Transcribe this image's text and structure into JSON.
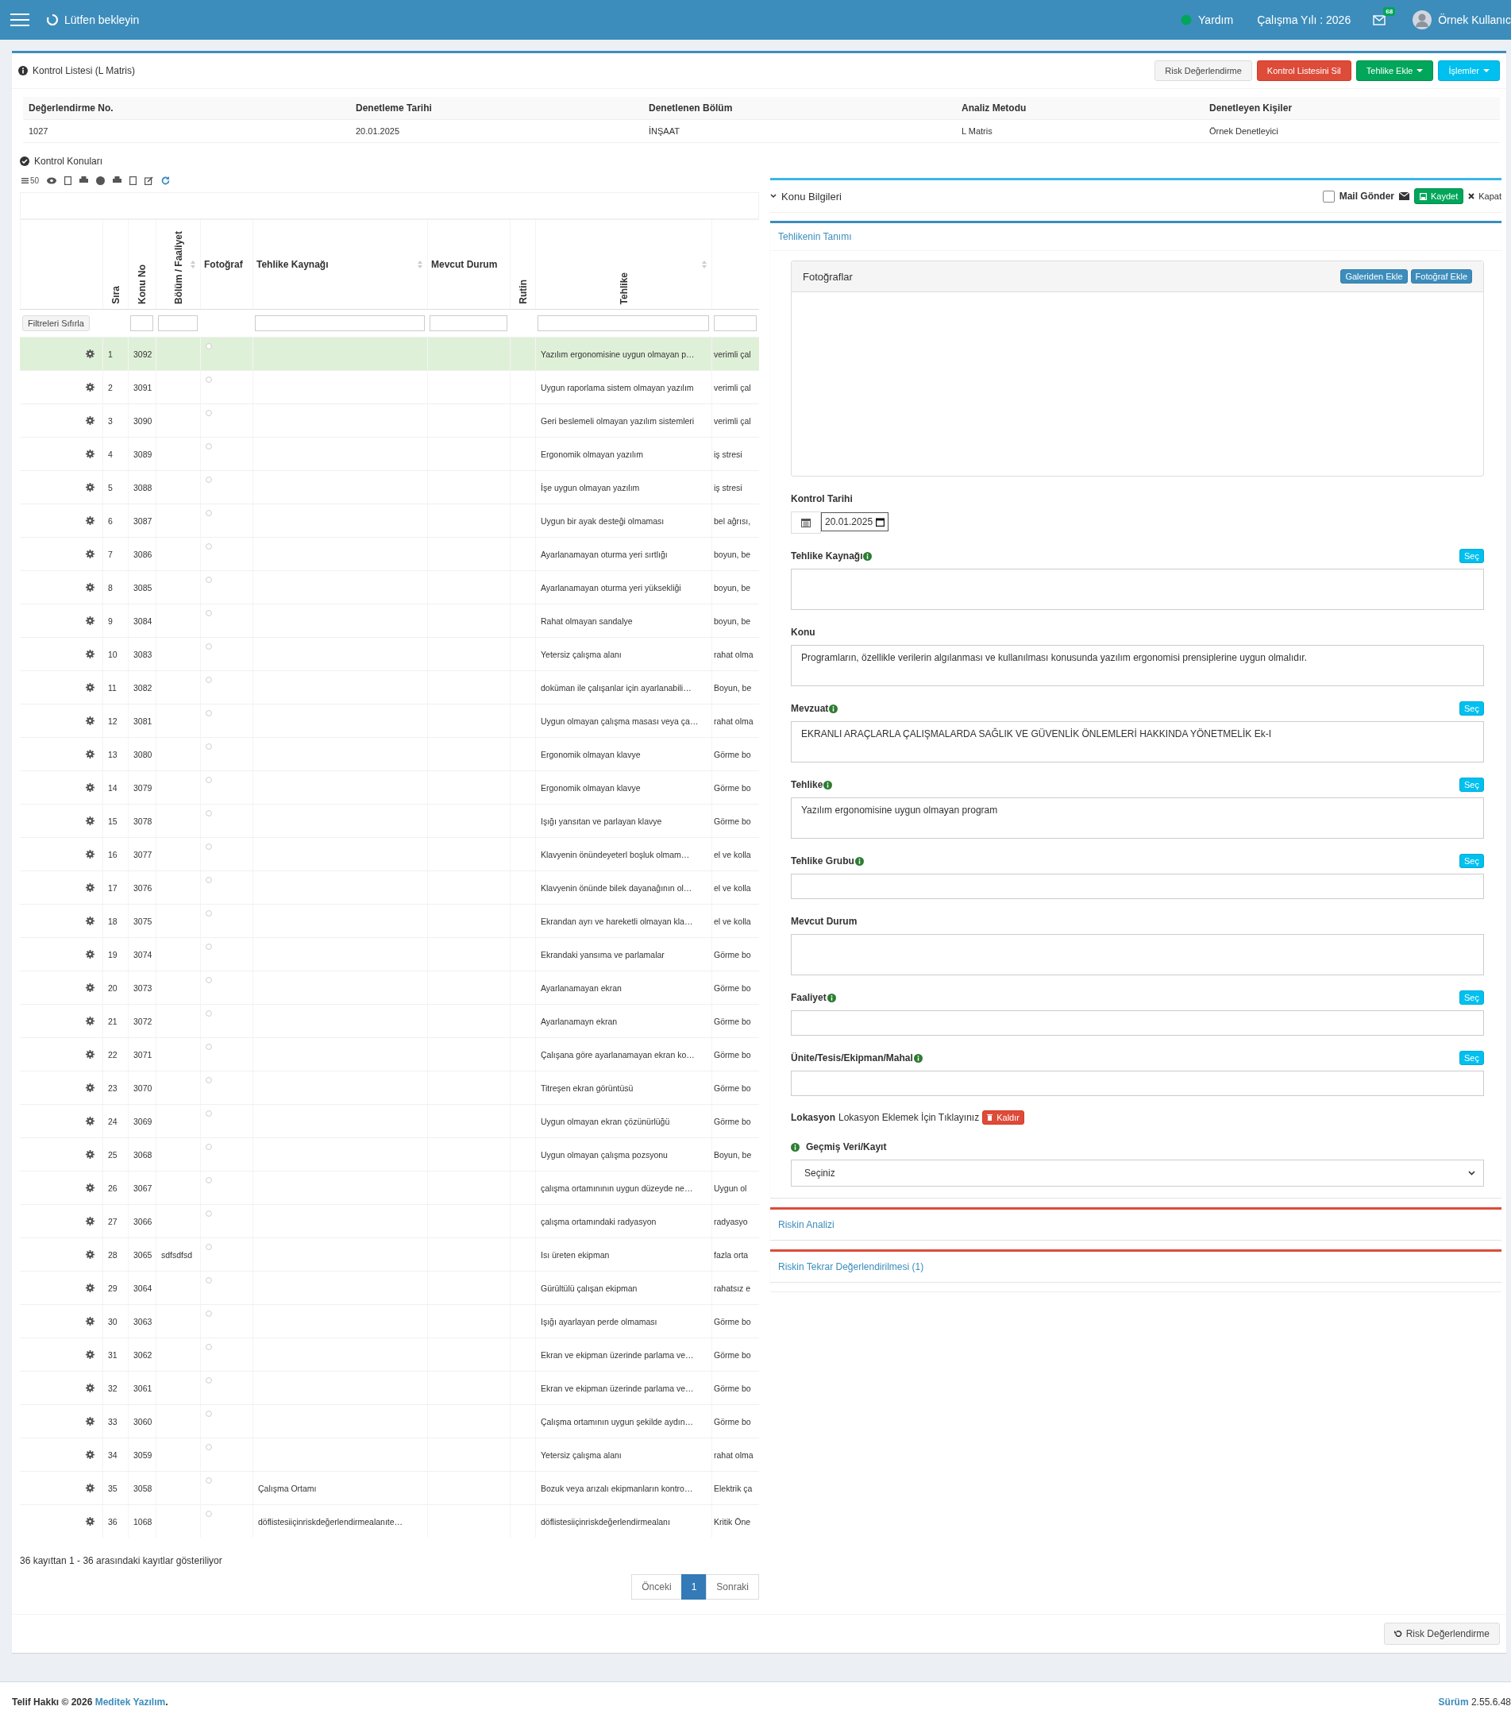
{
  "topbar": {
    "loading_text": "Lütfen bekleyin",
    "help": "Yardım",
    "year": "Çalışma Yılı : 2026",
    "mail_count": "68",
    "user": "Örnek Kullanıc"
  },
  "page": {
    "title": "Kontrol Listesi (L Matris)",
    "actions": [
      {
        "label": "Risk Değerlendirme",
        "kind": "default"
      },
      {
        "label": "Kontrol Listesini Sil",
        "kind": "danger"
      },
      {
        "label": "Tehlike Ekle",
        "kind": "success",
        "caret": true
      },
      {
        "label": "İşlemler",
        "kind": "info",
        "caret": true
      }
    ]
  },
  "summary": {
    "columns": [
      "Değerlendirme No.",
      "Denetleme Tarihi",
      "Denetlenen Bölüm",
      "Analiz Metodu",
      "Denetleyen Kişiler"
    ],
    "values": [
      "1027",
      "20.01.2025",
      "İNŞAAT",
      "L Matris",
      "Örnek Denetleyici"
    ]
  },
  "topics": {
    "title": "Kontrol Konuları",
    "page_size": "50",
    "filter_reset": "Filtreleri Sıfırla",
    "columns": [
      {
        "label": "Sıra",
        "vertical": true
      },
      {
        "label": "Konu No",
        "vertical": true,
        "filter": true
      },
      {
        "label": "Bölüm / Faaliyet",
        "vertical": true,
        "filter": true,
        "sortable": true
      },
      {
        "label": "Fotoğraf"
      },
      {
        "label": "Tehlike Kaynağı",
        "filter": true,
        "sortable": true
      },
      {
        "label": "Mevcut Durum",
        "filter": true
      },
      {
        "label": "Rutin",
        "vertical": true
      },
      {
        "label": "Tehlike",
        "vertical": true,
        "filter": true,
        "sortable": true
      },
      {
        "filter": true
      }
    ],
    "rows": [
      {
        "sira": "1",
        "konu_no": "3092",
        "tehlike": "Yazılım ergonomisine uygun olmayan p…",
        "column_10": "verimli çal",
        "selected": true
      },
      {
        "sira": "2",
        "konu_no": "3091",
        "tehlike": "Uygun raporlama sistem olmayan yazılım",
        "column_10": "verimli çal",
        "selected": false
      },
      {
        "sira": "3",
        "konu_no": "3090",
        "tehlike": "Geri beslemeli olmayan yazılım sistemleri",
        "column_10": "verimli çal",
        "selected": false
      },
      {
        "sira": "4",
        "konu_no": "3089",
        "tehlike": "Ergonomik olmayan yazılım",
        "column_10": "iş stresi",
        "selected": false
      },
      {
        "sira": "5",
        "konu_no": "3088",
        "tehlike": "İşe uygun olmayan yazılım",
        "column_10": "iş stresi",
        "selected": false
      },
      {
        "sira": "6",
        "konu_no": "3087",
        "tehlike": "Uygun bir ayak desteği olmaması",
        "column_10": "bel ağrısı,",
        "selected": false
      },
      {
        "sira": "7",
        "konu_no": "3086",
        "tehlike": "Ayarlanamayan oturma yeri sırtlığı",
        "column_10": "boyun, be",
        "selected": false
      },
      {
        "sira": "8",
        "konu_no": "3085",
        "tehlike": "Ayarlanamayan oturma yeri yüksekliği",
        "column_10": "boyun, be",
        "selected": false
      },
      {
        "sira": "9",
        "konu_no": "3084",
        "tehlike": "Rahat olmayan sandalye",
        "column_10": "boyun, be",
        "selected": false
      },
      {
        "sira": "10",
        "konu_no": "3083",
        "tehlike": "Yetersiz çalışma alanı",
        "column_10": "rahat olma",
        "selected": false
      },
      {
        "sira": "11",
        "konu_no": "3082",
        "tehlike": "doküman ile çalışanlar için ayarlanabili…",
        "column_10": "Boyun, be",
        "selected": false
      },
      {
        "sira": "12",
        "konu_no": "3081",
        "tehlike": "Uygun olmayan çalışma masası veya ça…",
        "column_10": "rahat olma",
        "selected": false
      },
      {
        "sira": "13",
        "konu_no": "3080",
        "tehlike": "Ergonomik olmayan klavye",
        "column_10": "Görme bo",
        "selected": false
      },
      {
        "sira": "14",
        "konu_no": "3079",
        "tehlike": "Ergonomik olmayan klavye",
        "column_10": "Görme bo",
        "selected": false
      },
      {
        "sira": "15",
        "konu_no": "3078",
        "tehlike": "Işığı yansıtan ve parlayan klavye",
        "column_10": "Görme bo",
        "selected": false
      },
      {
        "sira": "16",
        "konu_no": "3077",
        "tehlike": "Klavyenin önündeyeterl boşluk olmam…",
        "column_10": "el ve kolla",
        "selected": false
      },
      {
        "sira": "17",
        "konu_no": "3076",
        "tehlike": "Klavyenin önünde bilek dayanağının ol…",
        "column_10": "el ve kolla",
        "selected": false
      },
      {
        "sira": "18",
        "konu_no": "3075",
        "tehlike": "Ekrandan ayrı ve hareketli olmayan kla…",
        "column_10": "el ve kolla",
        "selected": false
      },
      {
        "sira": "19",
        "konu_no": "3074",
        "tehlike": "Ekrandaki yansıma ve parlamalar",
        "column_10": "Görme bo",
        "selected": false
      },
      {
        "sira": "20",
        "konu_no": "3073",
        "tehlike": "Ayarlanamayan ekran",
        "column_10": "Görme bo",
        "selected": false
      },
      {
        "sira": "21",
        "konu_no": "3072",
        "tehlike": "Ayarlanamayn ekran",
        "column_10": "Görme bo",
        "selected": false
      },
      {
        "sira": "22",
        "konu_no": "3071",
        "tehlike": "Çalışana göre ayarlanamayan ekran ko…",
        "column_10": "Görme bo",
        "selected": false
      },
      {
        "sira": "23",
        "konu_no": "3070",
        "tehlike": "Titreşen ekran görüntüsü",
        "column_10": "Görme bo",
        "selected": false
      },
      {
        "sira": "24",
        "konu_no": "3069",
        "tehlike": "Uygun olmayan ekran çözünürlüğü",
        "column_10": "Görme bo",
        "selected": false
      },
      {
        "sira": "25",
        "konu_no": "3068",
        "tehlike": "Uygun olmayan çalışma pozsyonu",
        "column_10": "Boyun, be",
        "selected": false
      },
      {
        "sira": "26",
        "konu_no": "3067",
        "tehlike": "çalışma ortamınının uygun düzeyde ne…",
        "column_10": "Uygun ol",
        "selected": false
      },
      {
        "sira": "27",
        "konu_no": "3066",
        "tehlike": "çalışma ortamındaki radyasyon",
        "column_10": "radyasyo",
        "selected": false
      },
      {
        "sira": "28",
        "konu_no": "3065",
        "bolum": "sdfsdfsd",
        "tehlike": "Isı üreten ekipman",
        "column_10": "fazla orta",
        "selected": false
      },
      {
        "sira": "29",
        "konu_no": "3064",
        "tehlike": "Gürültülü çalışan ekipman",
        "column_10": "rahatsız e",
        "selected": false
      },
      {
        "sira": "30",
        "konu_no": "3063",
        "tehlike": "Işığı ayarlayan perde olmaması",
        "column_10": "Görme bo",
        "selected": false
      },
      {
        "sira": "31",
        "konu_no": "3062",
        "tehlike": "Ekran ve ekipman üzerinde parlama ve…",
        "column_10": "Görme bo",
        "selected": false
      },
      {
        "sira": "32",
        "konu_no": "3061",
        "tehlike": "Ekran ve ekipman üzerinde parlama ve…",
        "column_10": "Görme bo",
        "selected": false
      },
      {
        "sira": "33",
        "konu_no": "3060",
        "tehlike": "Çalışma ortamının uygun şekilde aydın…",
        "column_10": "Görme bo",
        "selected": false
      },
      {
        "sira": "34",
        "konu_no": "3059",
        "tehlike": "Yetersiz çalışma alanı",
        "column_10": "rahat olma",
        "selected": false
      },
      {
        "sira": "35",
        "konu_no": "3058",
        "tehlike_kaynagi": "Çalışma Ortamı",
        "tehlike": "Bozuk veya arızalı ekipmanların kontro…",
        "column_10": "Elektrik ça",
        "selected": false
      },
      {
        "sira": "36",
        "konu_no": "1068",
        "tehlike_kaynagi": "döflistesiiçinriskdeğerlendirmealanıte…",
        "tehlike": "döflistesiiçinriskdeğerlendirmealanı",
        "column_10": "Kritik Öne",
        "selected": false
      }
    ],
    "info": "36 kayıttan 1 - 36 arasındaki kayıtlar gösteriliyor",
    "pagination": {
      "prev": "Önceki",
      "pages": [
        {
          "label": "1",
          "selected": true
        }
      ],
      "next": "Sonraki"
    }
  },
  "detail": {
    "title": "Konu Bilgileri",
    "mail": {
      "label": "Mail Gönder",
      "checked": false
    },
    "save": "Kaydet",
    "close": "Kapat",
    "section": "Tehlikenin Tanımı",
    "photos": {
      "title": "Fotoğraflar",
      "buttons": [
        "Galeriden Ekle",
        "Fotoğraf Ekle"
      ]
    },
    "date": {
      "label": "Kontrol Tarihi",
      "value": "20.01.2025"
    },
    "fields": [
      {
        "label": "Tehlike Kaynağı",
        "info": true,
        "select_button": "Seç",
        "kind": "textarea"
      },
      {
        "label": "Konu",
        "kind": "textarea",
        "value": "Programların, özellikle verilerin algılanması ve kullanılması konusunda yazılım ergonomisi prensiplerine uygun olmalıdır."
      },
      {
        "label": "Mevzuat",
        "info": true,
        "select_button": "Seç",
        "kind": "textarea",
        "value": "EKRANLI ARAÇLARLA ÇALIŞMALARDA SAĞLIK VE GÜVENLİK ÖNLEMLERİ HAKKINDA YÖNETMELİK Ek-I"
      },
      {
        "label": "Tehlike",
        "info": true,
        "select_button": "Seç",
        "kind": "textarea",
        "value": "Yazılım ergonomisine uygun olmayan program"
      },
      {
        "label": "Tehlike Grubu",
        "info": true,
        "select_button": "Seç",
        "kind": "input"
      },
      {
        "label": "Mevcut Durum",
        "kind": "textarea"
      },
      {
        "label": "Faaliyet",
        "info": true,
        "select_button": "Seç",
        "kind": "input"
      },
      {
        "label": "Ünite/Tesis/Ekipman/Mahal",
        "info": true,
        "select_button": "Seç",
        "kind": "input"
      }
    ],
    "location": {
      "label": "Lokasyon",
      "link": "Lokasyon Eklemek İçin Tıklayınız",
      "remove": "Kaldır"
    },
    "history": {
      "label": "Geçmiş Veri/Kayıt",
      "value": "Seçiniz"
    },
    "sections": [
      "Riskin Analizi",
      "Riskin Tekrar Değerlendirilmesi (1)"
    ]
  },
  "bottom_action": "Risk Değerlendirme",
  "footer": {
    "copyright": "Telif Hakkı © 2026",
    "company": "Meditek Yazılım",
    "copyright_end": ".",
    "version_label": "Sürüm",
    "version": "2.55.6.48"
  }
}
